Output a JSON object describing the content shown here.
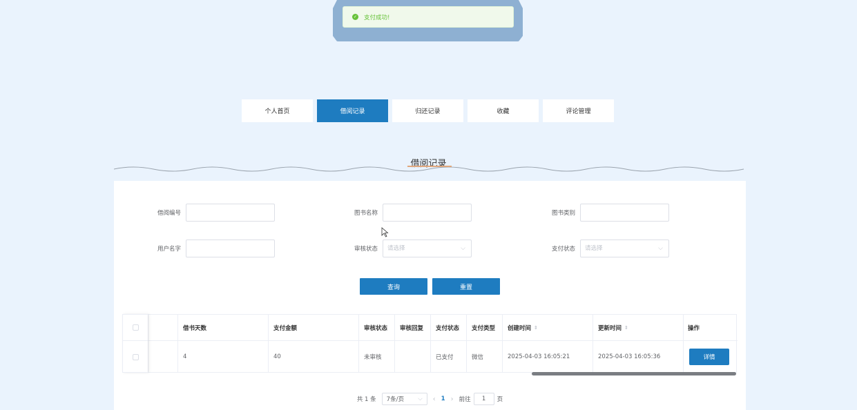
{
  "toast": {
    "message": "支付成功!",
    "icon": "check-circle-icon"
  },
  "tabs": [
    {
      "label": "个人首页",
      "active": false
    },
    {
      "label": "借阅记录",
      "active": true
    },
    {
      "label": "归还记录",
      "active": false
    },
    {
      "label": "收藏",
      "active": false
    },
    {
      "label": "评论管理",
      "active": false
    }
  ],
  "section": {
    "title": "借阅记录"
  },
  "filters": {
    "borrow_no": {
      "label": "借阅编号",
      "value": ""
    },
    "book_name": {
      "label": "图书名称",
      "value": ""
    },
    "book_category": {
      "label": "图书类别",
      "value": ""
    },
    "user_name": {
      "label": "用户名字",
      "value": ""
    },
    "review_status": {
      "label": "审核状态",
      "placeholder": "请选择"
    },
    "pay_status": {
      "label": "支付状态",
      "placeholder": "请选择"
    }
  },
  "buttons": {
    "query": "查询",
    "reset": "重置"
  },
  "table": {
    "headers": {
      "days": "借书天数",
      "amount": "支付金额",
      "review_status": "审核状态",
      "review_reply": "审核回复",
      "pay_status": "支付状态",
      "pay_type": "支付类型",
      "created": "创建时间",
      "updated": "更新时间",
      "action": "操作"
    },
    "rows": [
      {
        "days": "4",
        "amount": "40",
        "review_status": "未审核",
        "review_reply": "",
        "pay_status": "已支付",
        "pay_type": "微信",
        "created": "2025-04-03 16:05:21",
        "updated": "2025-04-03 16:05:36",
        "action": "详情"
      }
    ]
  },
  "pagination": {
    "total": "共 1 条",
    "page_size": "7条/页",
    "current_page": "1",
    "goto_prefix": "前往",
    "goto_value": "1",
    "goto_suffix": "页"
  },
  "colors": {
    "accent": "#1e7cc0",
    "success": "#67c23a",
    "background": "#eaf3fd"
  }
}
